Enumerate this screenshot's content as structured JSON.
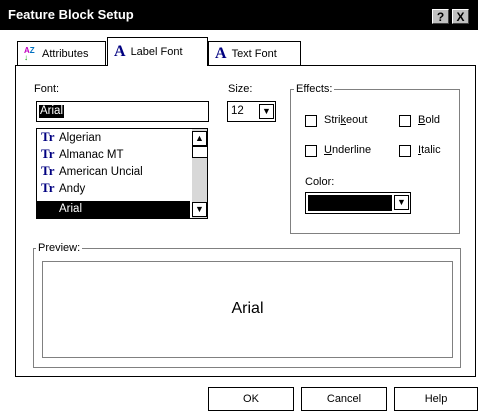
{
  "window": {
    "title": "Feature Block Setup",
    "help_button": "?",
    "close_button": "X"
  },
  "tabs": [
    {
      "label": "Attributes",
      "icon": "az-sort-icon"
    },
    {
      "label": "Label Font",
      "icon": "font-a-icon",
      "glyph": "A"
    },
    {
      "label": "Text Font",
      "icon": "font-a-icon",
      "glyph": "A"
    }
  ],
  "font": {
    "label": "Font:",
    "value": "Arial",
    "list": [
      "Algerian",
      "Almanac MT",
      "American Uncial",
      "Andy",
      "Arial"
    ],
    "selected": "Arial",
    "truetype_glyph": "Tr"
  },
  "size": {
    "label": "Size:",
    "value": "12"
  },
  "effects": {
    "legend": "Effects:",
    "strikeout": {
      "label_pre": "Stri",
      "label_u": "k",
      "label_post": "eout",
      "checked": false
    },
    "bold": {
      "label_pre": "",
      "label_u": "B",
      "label_post": "old",
      "checked": false
    },
    "underline": {
      "label_pre": "",
      "label_u": "U",
      "label_post": "nderline",
      "checked": false
    },
    "italic": {
      "label_pre": "",
      "label_u": "I",
      "label_post": "talic",
      "checked": false
    },
    "color_label": "Color:",
    "color_value": "#000000"
  },
  "preview": {
    "legend": "Preview:",
    "sample": "Arial"
  },
  "buttons": {
    "ok": "OK",
    "cancel": "Cancel",
    "help": "Help"
  }
}
